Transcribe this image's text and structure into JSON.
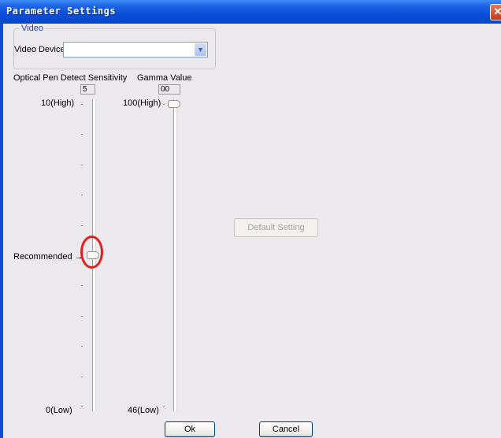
{
  "window": {
    "title": "Parameter Settings",
    "close_symbol": "✕"
  },
  "video_group": {
    "legend": "Video",
    "device_list_label": "Video Device List",
    "device_list_value": "",
    "dropdown_arrow": "▼"
  },
  "sensitivity": {
    "label": "Optical Pen Detect Sensitivity",
    "value": "5",
    "max_label": "10(High)",
    "min_label": "0(Low)",
    "recommended_label": "Recommended",
    "recommended_arrow": "→",
    "level": 5,
    "range": [
      0,
      10
    ]
  },
  "gamma": {
    "label": "Gamma Value",
    "value": "00",
    "max_label": "100(High)",
    "min_label": "46(Low)",
    "level": 100,
    "range": [
      46,
      100
    ]
  },
  "buttons": {
    "default_setting": "Default Setting",
    "ok": "Ok",
    "cancel": "Cancel"
  },
  "colors": {
    "titlebar": "#0a4ed8",
    "highlight_circle": "#e0201c",
    "dialog_bg": "#ebe9ed"
  }
}
